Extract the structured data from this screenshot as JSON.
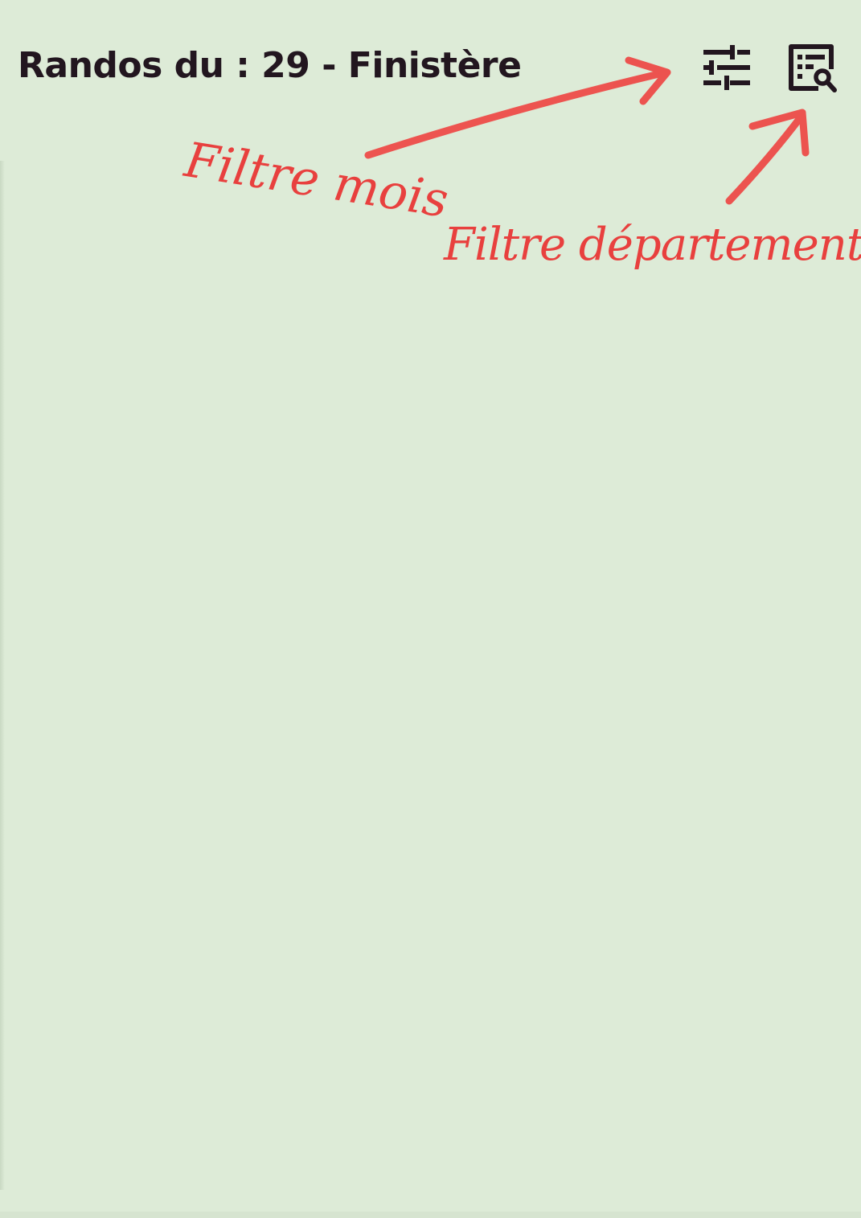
{
  "app_bar": {
    "title": "Randos du : 29 - Finistère",
    "actions": [
      {
        "id": "month-filter",
        "icon": "tune-icon"
      },
      {
        "id": "department-filter",
        "icon": "search-document-icon"
      }
    ]
  },
  "annotations": {
    "month_filter_label": "Filtre mois",
    "department_filter_label": "Filtre département",
    "color": "#e8403e"
  },
  "colors": {
    "background": "#ddebd7",
    "title_text": "#22161f",
    "icon": "#22161f"
  }
}
